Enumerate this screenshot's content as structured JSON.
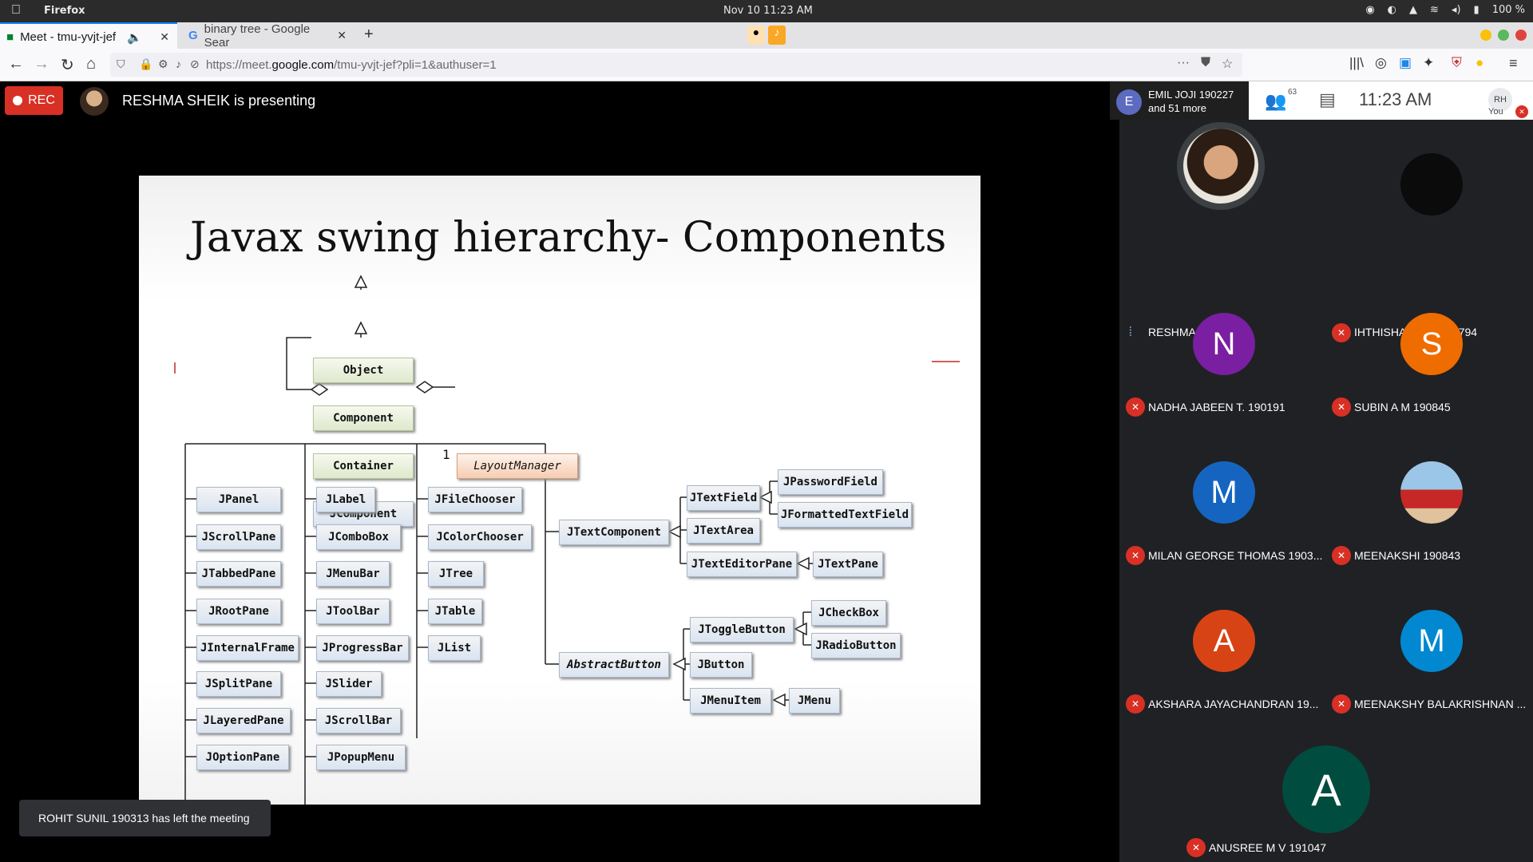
{
  "os": {
    "app_name": "Firefox",
    "datetime": "Nov 10  11:23 AM",
    "battery": "100 %"
  },
  "tabs": [
    {
      "title": "Meet - tmu-yvjt-jef",
      "active": true
    },
    {
      "title": "binary tree - Google Sear",
      "active": false
    }
  ],
  "url": {
    "prefix": "https://meet.",
    "domain": "google.com",
    "path": "/tmu-yvjt-jef?pli=1&authuser=1"
  },
  "meet": {
    "rec_label": "REC",
    "presenting_text": "RESHMA SHEIK is presenting",
    "toast": "ROHIT SUNIL 190313 has left the meeting",
    "participant_chip": {
      "initial": "E",
      "line1": "EMIL JOJI 190227",
      "line2": "and 51 more"
    },
    "people_count": "63",
    "time": "11:23  AM",
    "you_initials": "RH",
    "you_label": "You"
  },
  "slide": {
    "title": "Javax swing hierarchy- Components",
    "multiplicity": "1",
    "boxes": {
      "object": "Object",
      "component": "Component",
      "container": "Container",
      "layout_manager": "LayoutManager",
      "jcomponent": "JComponent",
      "col1": [
        "JPanel",
        "JScrollPane",
        "JTabbedPane",
        "JRootPane",
        "JInternalFrame",
        "JSplitPane",
        "JLayeredPane",
        "JOptionPane"
      ],
      "col2": [
        "JLabel",
        "JComboBox",
        "JMenuBar",
        "JToolBar",
        "JProgressBar",
        "JSlider",
        "JScrollBar",
        "JPopupMenu"
      ],
      "col3": [
        "JFileChooser",
        "JColorChooser",
        "JTree",
        "JTable",
        "JList"
      ],
      "jtextcomponent": "JTextComponent",
      "abstractbutton": "AbstractButton",
      "jtextfield": "JTextField",
      "jtextarea": "JTextArea",
      "jtexteditorpane": "JTextEditorPane",
      "jpasswordfield": "JPasswordField",
      "jformattedtextfield": "JFormattedTextField",
      "jtextpane": "JTextPane",
      "jtogglebutton": "JToggleButton",
      "jbutton": "JButton",
      "jmenuitem": "JMenuItem",
      "jcheckbox": "JCheckBox",
      "jradiobutton": "JRadioButton",
      "jmenu": "JMenu"
    }
  },
  "participants": [
    {
      "name": "RESHMA SHEIK",
      "initial": "",
      "color": "#3c4043",
      "muted": false,
      "photo": true
    },
    {
      "name": "IHTHISHAM K K 190794",
      "initial": "",
      "color": "#111111",
      "muted": true,
      "photo": true
    },
    {
      "name": "NADHA JABEEN T. 190191",
      "initial": "N",
      "color": "#7b1fa2",
      "muted": true
    },
    {
      "name": "SUBIN A M 190845",
      "initial": "S",
      "color": "#ef6c00",
      "muted": true
    },
    {
      "name": "MILAN GEORGE THOMAS 1903...",
      "initial": "M",
      "color": "#1565c0",
      "muted": true
    },
    {
      "name": "MEENAKSHI 190843",
      "initial": "",
      "color": "#c9a88c",
      "muted": true,
      "photo": true
    },
    {
      "name": "AKSHARA JAYACHANDRAN 19...",
      "initial": "A",
      "color": "#d84315",
      "muted": true
    },
    {
      "name": "MEENAKSHY BALAKRISHNAN ...",
      "initial": "M",
      "color": "#0288d1",
      "muted": true
    },
    {
      "name": "ANUSREE M V 191047",
      "initial": "A",
      "color": "#004d40",
      "muted": true
    }
  ]
}
